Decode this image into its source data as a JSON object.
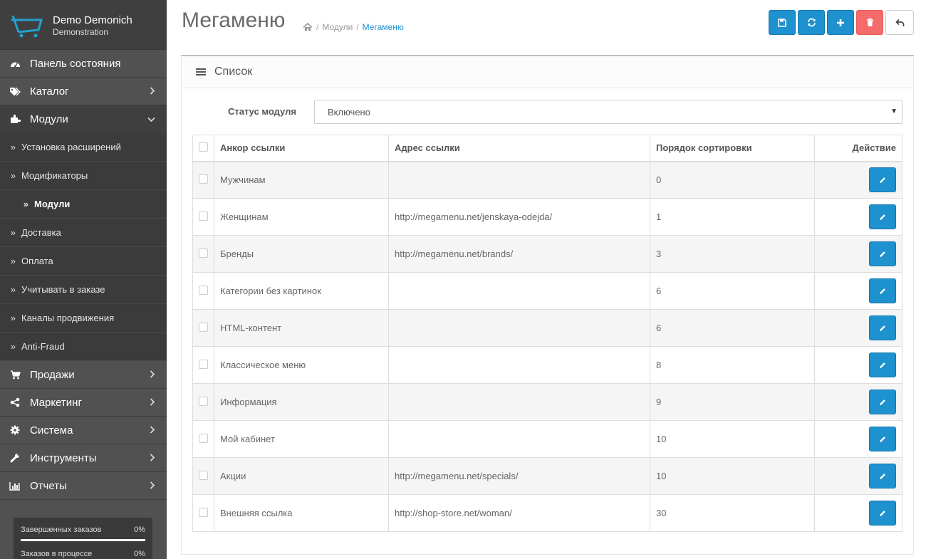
{
  "brand": {
    "name": "Demo Demonich",
    "sub": "Demonstration"
  },
  "sidebar": {
    "items_top": [
      {
        "label": "Панель состояния",
        "icon": "dashboard-icon"
      },
      {
        "label": "Каталог",
        "icon": "tags-icon"
      },
      {
        "label": "Модули",
        "icon": "puzzle-icon"
      }
    ],
    "sub_items": [
      {
        "label": "Установка расширений"
      },
      {
        "label": "Модификаторы"
      },
      {
        "label": "Модули"
      },
      {
        "label": "Доставка"
      },
      {
        "label": "Оплата"
      },
      {
        "label": "Учитывать в заказе"
      },
      {
        "label": "Каналы продвижения"
      },
      {
        "label": "Anti-Fraud"
      }
    ],
    "items_bottom": [
      {
        "label": "Продажи",
        "icon": "cart-icon"
      },
      {
        "label": "Маркетинг",
        "icon": "share-icon"
      },
      {
        "label": "Система",
        "icon": "gear-icon"
      },
      {
        "label": "Инструменты",
        "icon": "wrench-icon"
      },
      {
        "label": "Отчеты",
        "icon": "bar-chart-icon"
      }
    ],
    "progress": [
      {
        "label": "Завершенных заказов",
        "value": "0%"
      },
      {
        "label": "Заказов в процессе",
        "value": "0%"
      }
    ]
  },
  "header": {
    "title": "Мегаменю",
    "breadcrumb": [
      "Модули",
      "Мегаменю"
    ]
  },
  "panel": {
    "title": "Список",
    "status_label": "Статус модуля",
    "status_value": "Включено"
  },
  "table": {
    "headers": [
      "Анкор ссылки",
      "Адрес ссылки",
      "Порядок сортировки",
      "Действие"
    ],
    "rows": [
      {
        "anchor": "Мужчинам",
        "url": "",
        "sort": "0"
      },
      {
        "anchor": "Женщинам",
        "url": "http://megamenu.net/jenskaya-odejda/",
        "sort": "1"
      },
      {
        "anchor": "Бренды",
        "url": "http://megamenu.net/brands/",
        "sort": "3"
      },
      {
        "anchor": "Категории без картинок",
        "url": "",
        "sort": "6"
      },
      {
        "anchor": "HTML-контент",
        "url": "",
        "sort": "6"
      },
      {
        "anchor": "Классическое меню",
        "url": "",
        "sort": "8"
      },
      {
        "anchor": "Информация",
        "url": "",
        "sort": "9"
      },
      {
        "anchor": "Мой кабинет",
        "url": "",
        "sort": "10"
      },
      {
        "anchor": "Акции",
        "url": "http://megamenu.net/specials/",
        "sort": "10"
      },
      {
        "anchor": "Внешняя ссылка",
        "url": "http://shop-store.net/woman/",
        "sort": "30"
      }
    ]
  },
  "colors": {
    "primary": "#1e91cf",
    "danger": "#f56b6b",
    "sidebar": "#515151"
  }
}
